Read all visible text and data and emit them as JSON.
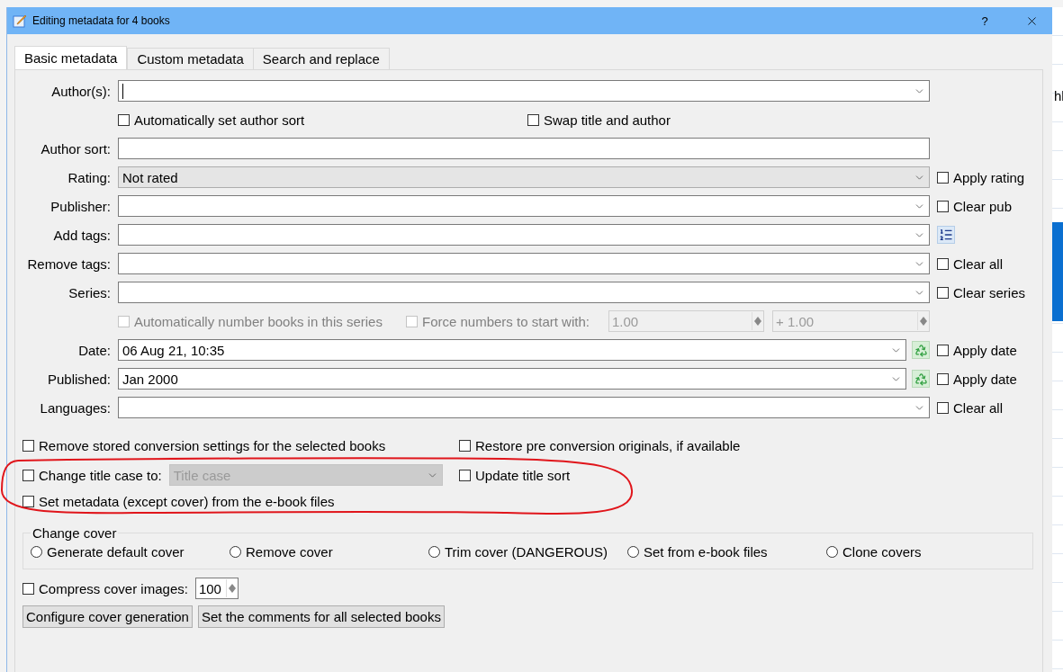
{
  "window": {
    "title": "Editing metadata for 4 books",
    "help": "?"
  },
  "background_app": {
    "text": "hl"
  },
  "tabs": [
    {
      "label": "Basic metadata",
      "selected": true
    },
    {
      "label": "Custom metadata",
      "selected": false
    },
    {
      "label": "Search and replace",
      "selected": false
    }
  ],
  "form_rows": [
    {
      "kind": "combo",
      "label": "Author(s):",
      "value": "",
      "focused": true
    },
    {
      "kind": "checks",
      "items": [
        {
          "label": "Automatically set author sort",
          "checked": false
        },
        {
          "label": "Swap title and author",
          "checked": false
        }
      ]
    },
    {
      "kind": "text",
      "label": "Author sort:",
      "value": ""
    },
    {
      "kind": "select",
      "label": "Rating:",
      "value": "Not rated",
      "extra": {
        "kind": "checkbox",
        "label": "Apply rating",
        "checked": false
      }
    },
    {
      "kind": "combo",
      "label": "Publisher:",
      "value": "",
      "extra": {
        "kind": "checkbox",
        "label": "Clear pub",
        "checked": false
      }
    },
    {
      "kind": "combo",
      "label": "Add tags:",
      "value": "",
      "extra": {
        "kind": "tag-button"
      }
    },
    {
      "kind": "combo",
      "label": "Remove tags:",
      "value": "",
      "extra": {
        "kind": "checkbox",
        "label": "Clear all",
        "checked": false
      }
    },
    {
      "kind": "combo",
      "label": "Series:",
      "value": "",
      "extra": {
        "kind": "checkbox",
        "label": "Clear series",
        "checked": false
      }
    },
    {
      "kind": "series-options",
      "items": [
        {
          "label": "Automatically number books in this series",
          "checked": false,
          "disabled": true
        },
        {
          "label": "Force numbers to start with:",
          "checked": false,
          "disabled": true
        }
      ],
      "spinners": [
        {
          "value": "1.00",
          "disabled": true
        },
        {
          "value": "+ 1.00",
          "disabled": true
        }
      ]
    },
    {
      "kind": "date",
      "label": "Date:",
      "value": "06 Aug 21, 10:35",
      "extra": {
        "kind": "checkbox",
        "label": "Apply date",
        "checked": false
      }
    },
    {
      "kind": "date",
      "label": "Published:",
      "value": "Jan 2000",
      "extra": {
        "kind": "checkbox",
        "label": "Apply date",
        "checked": false
      }
    },
    {
      "kind": "combo",
      "label": "Languages:",
      "value": "",
      "extra": {
        "kind": "checkbox",
        "label": "Clear all",
        "checked": false
      }
    }
  ],
  "options": [
    [
      {
        "kind": "checkbox",
        "label": "Remove stored conversion settings for the selected books",
        "checked": false
      },
      {
        "kind": "checkbox",
        "label": "Restore pre conversion originals, if available",
        "checked": false
      }
    ],
    [
      {
        "kind": "checkbox",
        "label": "Change title case to:",
        "checked": false,
        "select": {
          "value": "Title case",
          "disabled": true
        }
      },
      {
        "kind": "checkbox",
        "label": "Update title sort",
        "checked": false
      }
    ],
    [
      {
        "kind": "checkbox",
        "label": "Set metadata (except cover) from the e-book files",
        "checked": false
      }
    ]
  ],
  "cover": {
    "title": "Change cover",
    "radios": [
      {
        "label": "Generate default cover",
        "selected": false
      },
      {
        "label": "Remove cover",
        "selected": false
      },
      {
        "label": "Trim cover (DANGEROUS)",
        "selected": false
      },
      {
        "label": "Set from e-book files",
        "selected": false
      },
      {
        "label": "Clone covers",
        "selected": false
      }
    ]
  },
  "compress": {
    "label": "Compress cover images:",
    "checked": false,
    "value": "100"
  },
  "buttons": [
    "Configure cover generation",
    "Set the comments for all selected books"
  ]
}
